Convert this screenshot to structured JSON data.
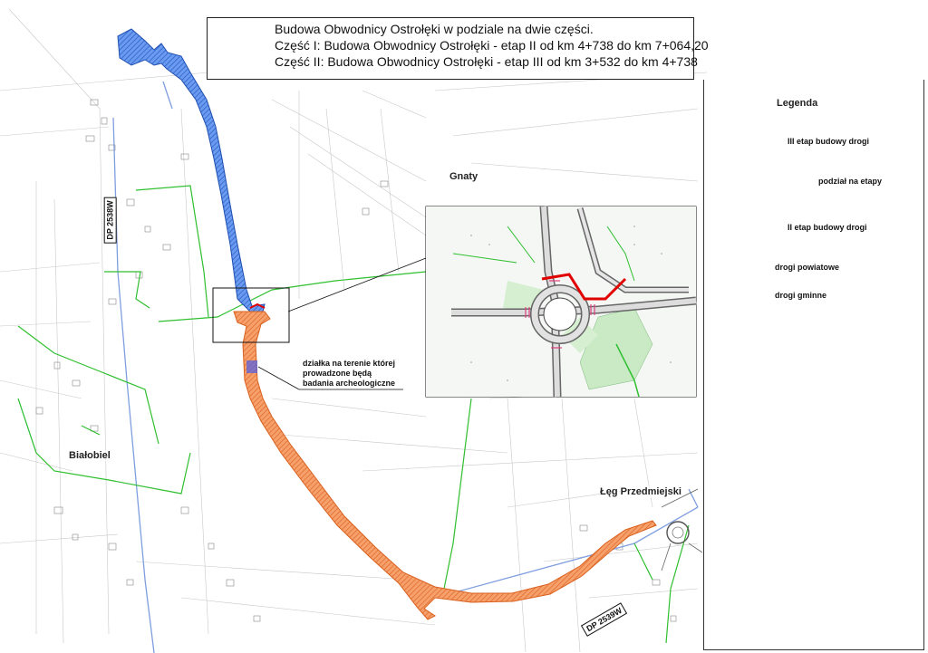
{
  "title": {
    "line1": "Budowa Obwodnicy Ostrołęki w podziale na dwie części.",
    "line2": "Część I: Budowa Obwodnicy Ostrołęki - etap II od km 4+738 do km 7+064,20",
    "line3": "Część II: Budowa Obwodnicy Ostrołęki  - etap III od km 3+532 do km 4+738"
  },
  "legend": {
    "title": "Legenda",
    "items": [
      {
        "label": "III etap budowy drogi",
        "color": "#4a7fe0",
        "icon": "blue-hatched-area-icon"
      },
      {
        "label": "podział na etapy",
        "color": "#e00000",
        "icon": "red-line-icon"
      },
      {
        "label": "II etap budowy drogi",
        "color": "#f08a4b",
        "icon": "orange-hatched-area-icon"
      },
      {
        "label": "drogi powiatowe",
        "color": "#7f9ee0",
        "icon": "blue-line-icon"
      },
      {
        "label": "drogi gminne",
        "color": "#2fbf2f",
        "icon": "green-line-icon"
      }
    ]
  },
  "places": {
    "gnaty": "Gnaty",
    "bialobiel": "Białobiel",
    "leg": "Łęg Przedmiejski"
  },
  "road_signs": {
    "dp2538": "DP 2538W",
    "dp2539": "DP 2539W"
  },
  "annotation": {
    "line1": "działka na terenie której",
    "line2": "prowadzone będą",
    "line3": "badania archeologiczne"
  },
  "colors": {
    "blue_stage": "#4a7fe0",
    "orange_stage": "#f08a4b",
    "division": "#e00000",
    "county_road": "#7f9ee0",
    "municipal_road": "#2fbf2f"
  }
}
